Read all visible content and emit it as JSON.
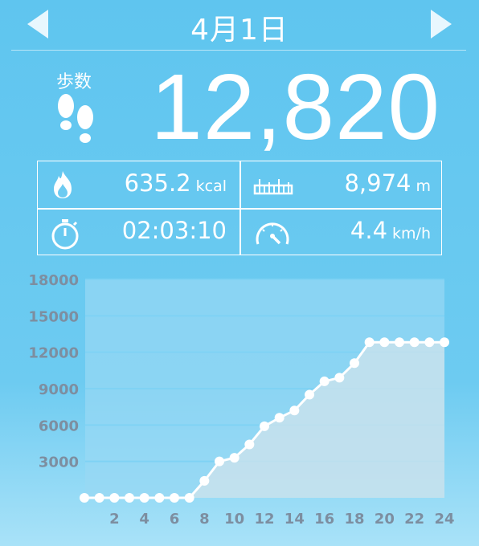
{
  "header": {
    "date": "4月1日",
    "prev_icon": "left-triangle-icon",
    "next_icon": "right-triangle-icon"
  },
  "steps": {
    "label": "歩数",
    "value": "12,820",
    "icon": "footsteps-icon"
  },
  "stats": {
    "calories": {
      "value": "635.2",
      "unit": "kcal",
      "icon": "flame-icon"
    },
    "distance": {
      "value": "8,974",
      "unit": "m",
      "icon": "ruler-icon"
    },
    "duration": {
      "value": "02:03:10",
      "icon": "stopwatch-icon"
    },
    "speed": {
      "value": "4.4",
      "unit": "km/h",
      "icon": "speedometer-icon"
    }
  },
  "chart_data": {
    "type": "area",
    "x": [
      0,
      1,
      2,
      3,
      4,
      5,
      6,
      7,
      8,
      9,
      10,
      11,
      12,
      13,
      14,
      15,
      16,
      17,
      18,
      19,
      20,
      21,
      22,
      23,
      24
    ],
    "values": [
      0,
      0,
      0,
      0,
      0,
      0,
      0,
      0,
      1400,
      3000,
      3300,
      4400,
      5900,
      6600,
      7200,
      8500,
      9600,
      9900,
      11100,
      12820,
      12820,
      12820,
      12820,
      12820,
      12820
    ],
    "xticks": [
      "2",
      "4",
      "6",
      "8",
      "10",
      "12",
      "14",
      "16",
      "18",
      "20",
      "22",
      "24"
    ],
    "yticks": [
      "3000",
      "6000",
      "9000",
      "12000",
      "15000",
      "18000"
    ],
    "ylim": [
      0,
      18000
    ],
    "xlim": [
      0,
      24
    ],
    "grid": true,
    "colors": {
      "line": "#ffffff",
      "fill": "#cfe3ec",
      "grid": "#7fd2f4",
      "tick": "#7d8ea0"
    }
  }
}
